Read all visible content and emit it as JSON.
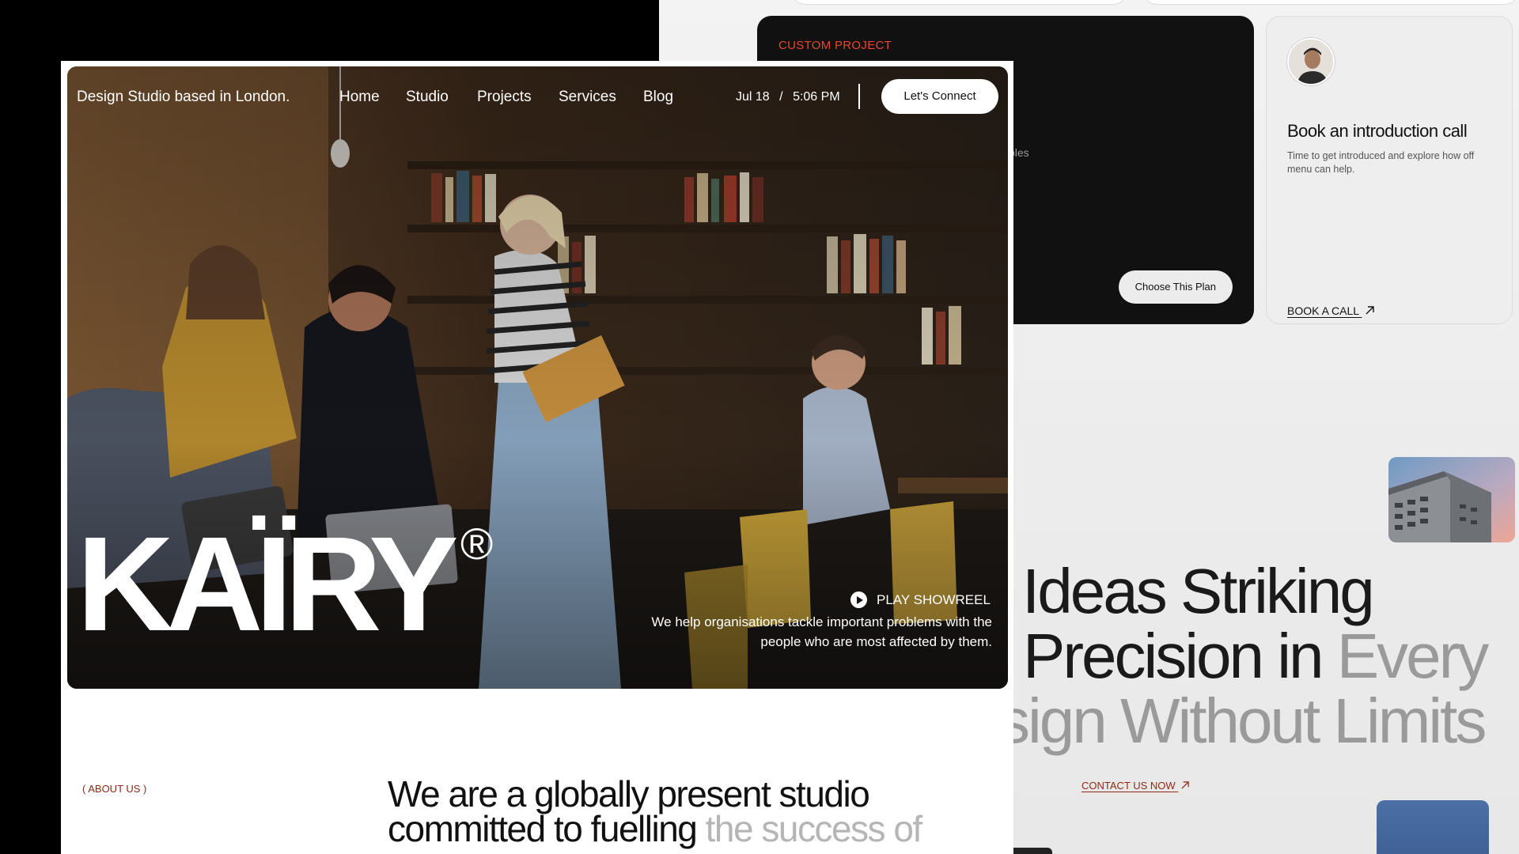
{
  "background_page": {
    "plan_card": {
      "label": "CUSTOM PROJECT",
      "fragments": [
        "s",
        "bles"
      ],
      "cta": "Choose This Plan"
    },
    "book_card": {
      "title": "Book an introduction call",
      "description": "Time to get introduced and explore how off menu can help.",
      "cta": "BOOK A CALL",
      "cta_icon": "arrow-up-right-icon"
    },
    "headline": {
      "line1": "l Ideas Striking",
      "line2_dark": "Precision in",
      "line2_grey": "Every",
      "line3": "sign Without Limits"
    },
    "contact_link": "CONTACT US NOW",
    "contact_icon": "arrow-up-right-icon"
  },
  "front_page": {
    "nav": {
      "tagline": "Design Studio based in London.",
      "links": [
        "Home",
        "Studio",
        "Projects",
        "Services",
        "Blog"
      ],
      "date": "Jul 18",
      "date_sep": "/",
      "time": "5:06 PM",
      "cta": "Let's Connect"
    },
    "hero": {
      "brand": "KAÏRY",
      "registered": "®",
      "showreel": "PLAY SHOWREEL",
      "showreel_icon": "play-icon",
      "description": "We help organisations tackle important problems with the people who are most affected by them."
    },
    "about": {
      "label": "( ABOUT US )",
      "text_dark": "We are a globally present studio committed to fuelling",
      "text_grey": "the success of"
    }
  },
  "colors": {
    "accent_orange": "#e8472d",
    "accent_rust": "#8f2a15",
    "dark": "#111111",
    "white": "#ffffff",
    "grey_text": "#9a9a9a"
  }
}
